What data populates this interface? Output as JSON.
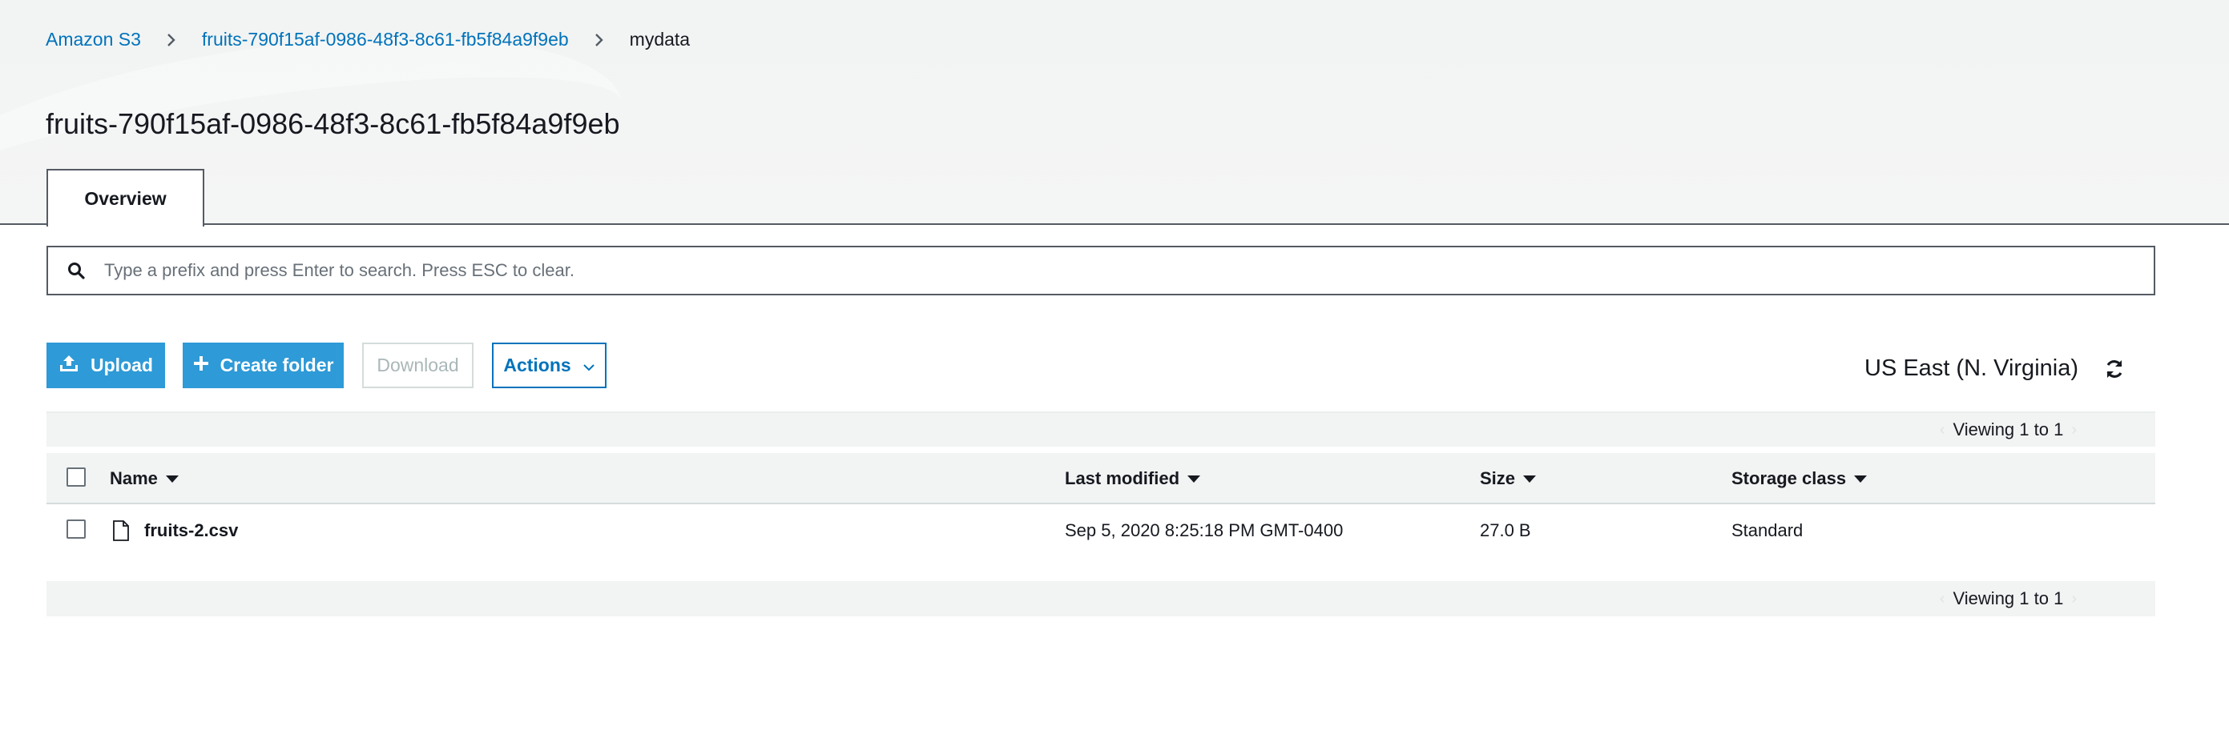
{
  "breadcrumb": {
    "root": "Amazon S3",
    "bucket": "fruits-790f15af-0986-48f3-8c61-fb5f84a9f9eb",
    "current": "mydata"
  },
  "page_title": "fruits-790f15af-0986-48f3-8c61-fb5f84a9f9eb",
  "tabs": [
    {
      "label": "Overview",
      "active": true
    }
  ],
  "search": {
    "placeholder": "Type a prefix and press Enter to search. Press ESC to clear.",
    "value": ""
  },
  "toolbar": {
    "upload_label": "Upload",
    "create_folder_label": "Create folder",
    "download_label": "Download",
    "actions_label": "Actions"
  },
  "region": "US East (N. Virginia)",
  "pagination": {
    "top": "Viewing 1 to 1",
    "bottom": "Viewing 1 to 1"
  },
  "table": {
    "columns": [
      "Name",
      "Last modified",
      "Size",
      "Storage class"
    ],
    "rows": [
      {
        "name": "fruits-2.csv",
        "last_modified": "Sep 5, 2020 8:25:18 PM GMT-0400",
        "size": "27.0 B",
        "storage_class": "Standard"
      }
    ]
  },
  "colors": {
    "accent": "#0073bb",
    "primary_button": "#2e9ad7",
    "border_dark": "#545b64",
    "header_bg": "#f2f3f3"
  },
  "icons": [
    "chevron-right-icon",
    "search-icon",
    "upload-icon",
    "plus-icon",
    "chevron-down-icon",
    "refresh-icon",
    "file-icon",
    "caret-down-icon"
  ]
}
